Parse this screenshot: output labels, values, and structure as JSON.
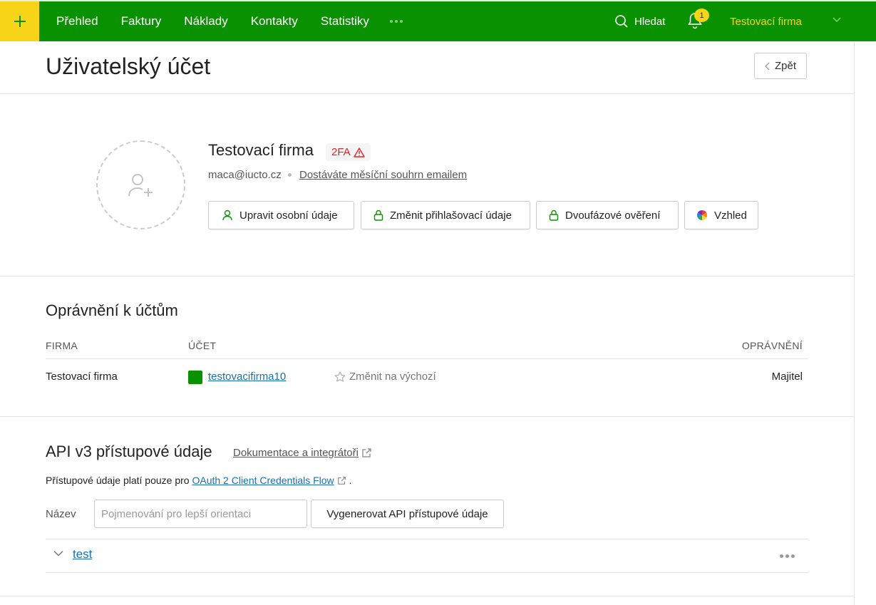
{
  "topbar": {
    "nav": [
      "Přehled",
      "Faktury",
      "Náklady",
      "Kontakty",
      "Statistiky"
    ],
    "search_label": "Hledat",
    "notification_count": "1",
    "company": "Testovací firma",
    "colors": {
      "bar": "#0a9100",
      "accent": "#f7d417"
    }
  },
  "header": {
    "title": "Uživatelský účet",
    "back_label": "Zpět"
  },
  "profile": {
    "name": "Testovací firma",
    "badge": "2FA",
    "email": "maca@iucto.cz",
    "summary_link": "Dostáváte měsíční souhrn emailem",
    "actions": [
      "Upravit osobní údaje",
      "Změnit přihlašovací údaje",
      "Dvoufázové ověření",
      "Vzhled"
    ]
  },
  "permissions": {
    "title": "Oprávnění k účtům",
    "headers": {
      "company": "FIRMA",
      "account": "ÚČET",
      "permission": "OPRÁVNĚNÍ"
    },
    "rows": [
      {
        "company": "Testovací firma",
        "account": "testovacifirma10",
        "set_default": "Změnit na výchozí",
        "permission": "Majitel"
      }
    ]
  },
  "api": {
    "title": "API v3 přístupové údaje",
    "doc_link": "Dokumentace a integrátoři",
    "note_prefix": "Přístupové údaje platí pouze pro ",
    "note_link": "OAuth 2 Client Credentials Flow",
    "note_suffix": ".",
    "name_label": "Název",
    "name_placeholder": "Pojmenování pro lepší orientaci",
    "generate_label": "Vygenerovat API přístupové údaje",
    "tokens": [
      "test"
    ]
  }
}
